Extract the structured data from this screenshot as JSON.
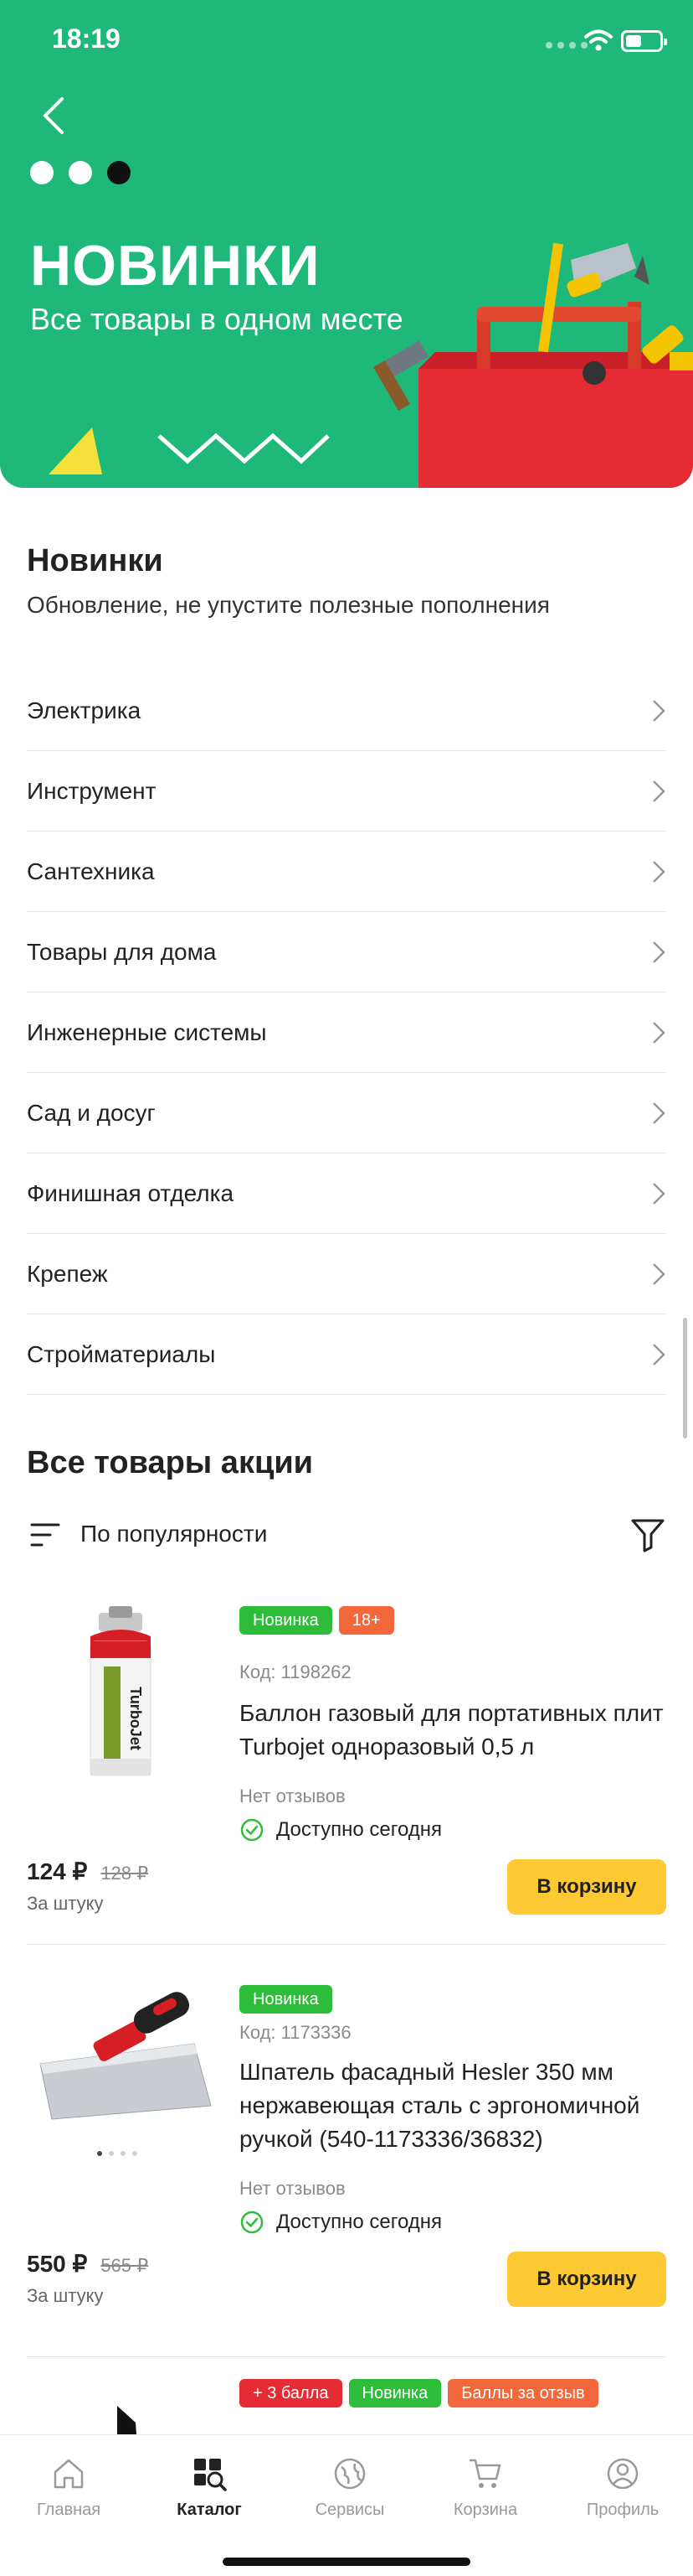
{
  "status_bar": {
    "time": "18:19"
  },
  "hero": {
    "title": "НОВИНКИ",
    "subtitle": "Все товары в одном месте",
    "bg_color": "#1db87a"
  },
  "intro": {
    "title": "Новинки",
    "description": "Обновление, не упустите полезные пополнения"
  },
  "categories": [
    {
      "label": "Электрика"
    },
    {
      "label": "Инструмент"
    },
    {
      "label": "Сантехника"
    },
    {
      "label": "Товары для дома"
    },
    {
      "label": "Инженерные системы"
    },
    {
      "label": "Сад и досуг"
    },
    {
      "label": "Финишная отделка"
    },
    {
      "label": "Крепеж"
    },
    {
      "label": "Стройматериалы"
    }
  ],
  "products_section": {
    "title": "Все товары акции",
    "sort_label": "По популярности"
  },
  "products": [
    {
      "badges": [
        "Новинка",
        "18+"
      ],
      "code": "Код: 1198262",
      "name_lines": [
        "Баллон газовый для портативных плит",
        "Turbojet одноразовый 0,5 л"
      ],
      "reviews": "Нет отзывов",
      "availability": "Доступно сегодня",
      "price": "124 ₽",
      "old_price": "128 ₽",
      "unit": "За штуку",
      "cart_label": "В корзину",
      "image_label": "TurboJet"
    },
    {
      "badges": [
        "Новинка"
      ],
      "code": "Код: 1173336",
      "name_lines": [
        "Шпатель фасадный Hesler 350 мм",
        "нержавеющая сталь с эргономичной",
        "ручкой (540-1173336/36832)"
      ],
      "reviews": "Нет отзывов",
      "availability": "Доступно сегодня",
      "price": "550 ₽",
      "old_price": "565 ₽",
      "unit": "За штуку",
      "cart_label": "В корзину"
    },
    {
      "badges": [
        "+ 3 балла",
        "Новинка",
        "Баллы за отзыв"
      ]
    }
  ],
  "tabbar": {
    "items": [
      {
        "label": "Главная",
        "icon": "home-icon"
      },
      {
        "label": "Каталог",
        "icon": "catalog-icon"
      },
      {
        "label": "Сервисы",
        "icon": "services-icon"
      },
      {
        "label": "Корзина",
        "icon": "cart-icon"
      },
      {
        "label": "Профиль",
        "icon": "profile-icon"
      }
    ],
    "active": "Каталог"
  },
  "colors": {
    "accent_green": "#2ebd3b",
    "badge_orange": "#f2683a",
    "badge_red": "#e52c35",
    "cart_button": "#ffc933"
  }
}
